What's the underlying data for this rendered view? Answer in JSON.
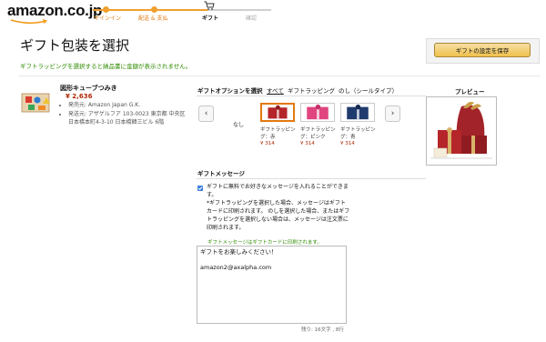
{
  "header": {
    "logo_text": "amazon.co.jp",
    "steps": [
      {
        "label": "サインイン"
      },
      {
        "label": "配送 & 支払"
      },
      {
        "label": "ギフト"
      },
      {
        "label": "確認"
      }
    ]
  },
  "page": {
    "title": "ギフト包装を選択",
    "subtitle": "ギフトラッピングを選択すると納品書に金額が表示されません。",
    "save_button": "ギフトの設定を保存"
  },
  "product": {
    "name": "図形キューブつみき",
    "price": "¥ 2,636",
    "details": [
      "発売元: Amazon Japan G.K.",
      "発送元: アザゲルフア 103-0023 東京都 中央区日本橋本町4-3-10 日本橋韓三ビル 6階"
    ]
  },
  "gift_options": {
    "label": "ギフトオプションを選択",
    "tabs": [
      "すべて",
      "ギフトラッピング",
      "のし（シールタイプ）"
    ],
    "none_label": "なし",
    "items": [
      {
        "name": "ギフトラッピング：赤",
        "price": "¥ 314",
        "color": "#b5262a"
      },
      {
        "name": "ギフトラッピング：ピンク",
        "price": "¥ 314",
        "color": "#e0457f"
      },
      {
        "name": "ギフトラッピング：青",
        "price": "¥ 314",
        "color": "#1f3a6e"
      }
    ]
  },
  "preview": {
    "title": "プレビュー"
  },
  "message": {
    "title": "ギフトメッセージ",
    "checkbox_label": "ギフトに無料でお好きなメッセージを入れることができます。",
    "notice": "*ギフトラッピングを選択した場合、メッセージはギフトカードに印刷されます。 のしを選択した場合、またはギフトラッピングを選択しない場合は、メッセージは注文票に印刷されます。",
    "print_note": "ギフトメッセージはギフトカードに印刷されます。",
    "value": "ギフトをお楽しみください！\n\namazon2@axalpha.com",
    "char_count": "残り: 16文字 , 8行"
  },
  "colors": {
    "accent": "#e47911",
    "price": "#b12704",
    "note_green": "#2e8b00",
    "button_yellow": "#f0c14b"
  }
}
